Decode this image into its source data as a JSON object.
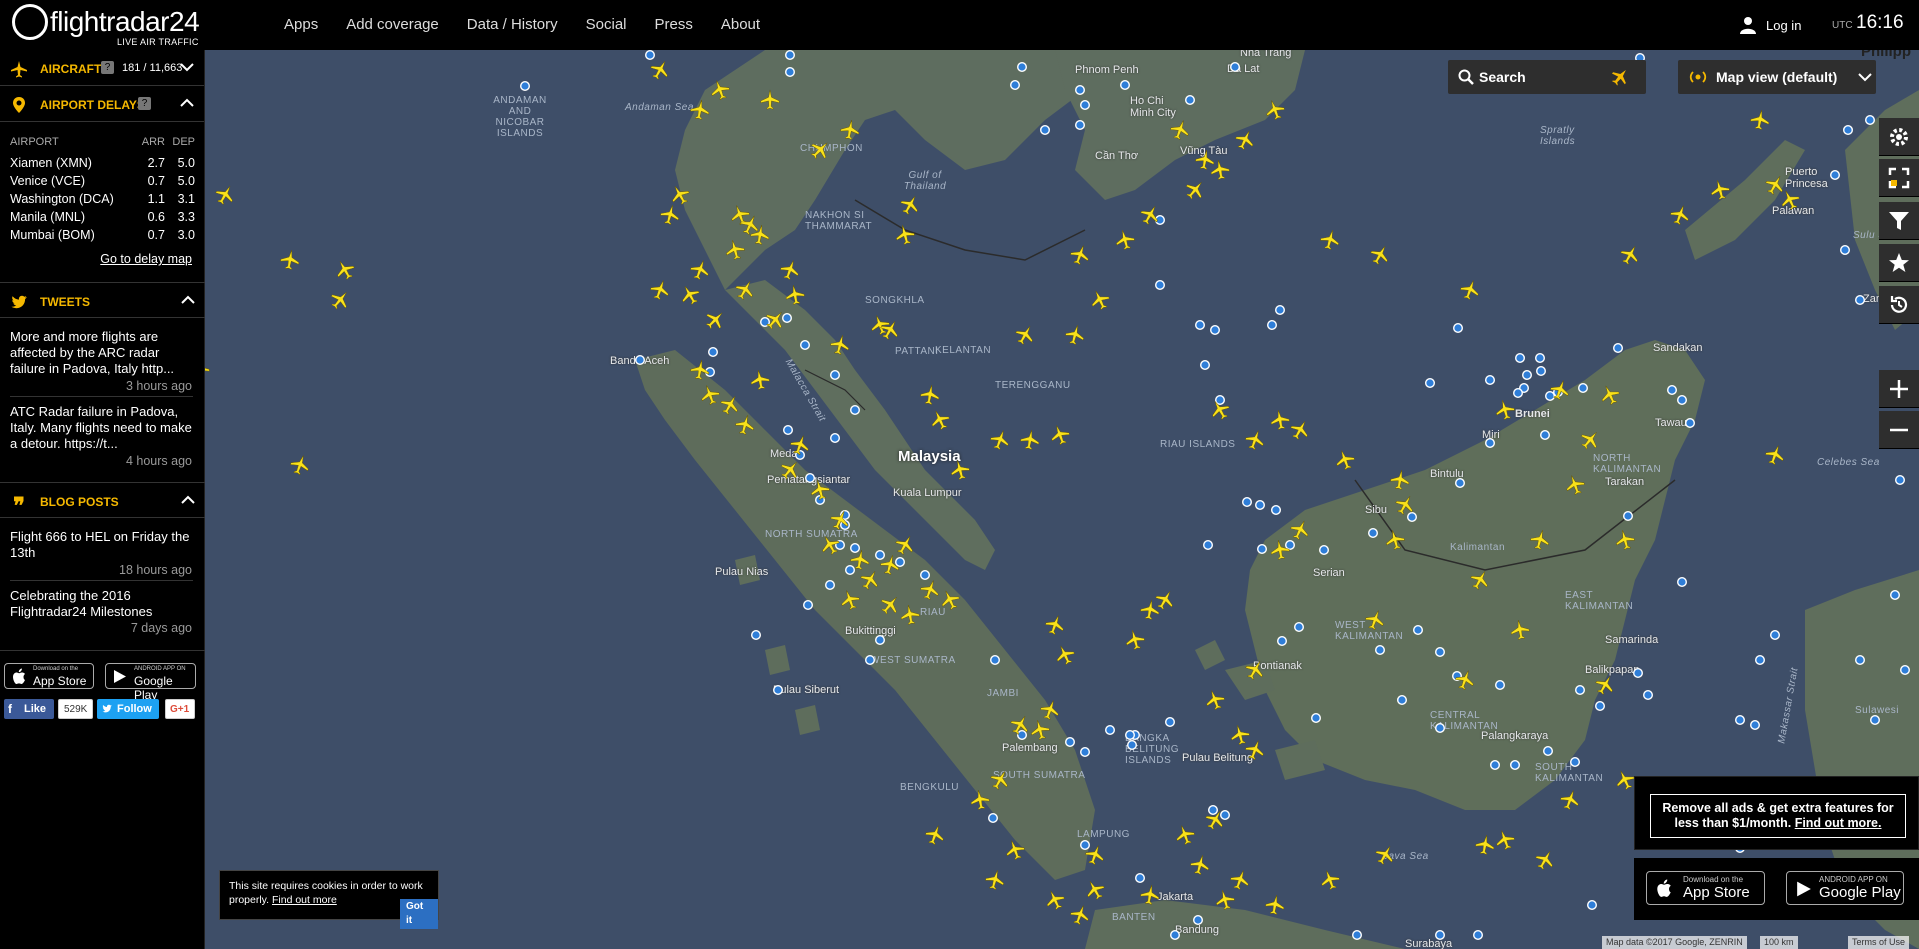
{
  "header": {
    "logo_text": "flightradar24",
    "logo_sub": "LIVE AIR TRAFFIC",
    "nav": [
      "Apps",
      "Add coverage",
      "Data / History",
      "Social",
      "Press",
      "About"
    ],
    "login_label": "Log in",
    "utc_label": "UTC",
    "time": "16:16"
  },
  "sidebar": {
    "aircraft": {
      "title": "AIRCRAFT",
      "count": "181 / 11,663",
      "help": "?"
    },
    "delays": {
      "title": "AIRPORT DELAYS",
      "help": "?",
      "headers": [
        "AIRPORT",
        "ARR",
        "DEP"
      ],
      "rows": [
        [
          "Xiamen (XMN)",
          "2.7",
          "5.0"
        ],
        [
          "Venice (VCE)",
          "0.7",
          "5.0"
        ],
        [
          "Washington (DCA)",
          "1.1",
          "3.1"
        ],
        [
          "Manila (MNL)",
          "0.6",
          "3.3"
        ],
        [
          "Mumbai (BOM)",
          "0.7",
          "3.0"
        ]
      ],
      "link": "Go to delay map"
    },
    "tweets": {
      "title": "TWEETS",
      "items": [
        {
          "text": "More and more flights are affected by the ARC radar failure in Padova, Italy http...",
          "ago": "3 hours ago"
        },
        {
          "text": "ATC Radar failure in Padova, Italy. Many flights need to make a detour. https://t...",
          "ago": "4 hours ago"
        }
      ]
    },
    "blog": {
      "title": "BLOG POSTS",
      "items": [
        {
          "text": "Flight 666 to HEL on Friday the 13th",
          "ago": "18 hours ago"
        },
        {
          "text": "Celebrating the 2016 Flightradar24 Milestones",
          "ago": "7 days ago"
        }
      ]
    },
    "stores": {
      "apple_small": "Download on the",
      "apple_big": "App Store",
      "google_small": "ANDROID APP ON",
      "google_big": "Google Play"
    },
    "social": {
      "like": "Like",
      "like_count": "529K",
      "follow": "Follow",
      "gplus": "G+1"
    }
  },
  "map": {
    "search_label": "Search",
    "mapview_label": "Map view (default)",
    "labels": {
      "andaman": "ANDAMAN AND NICOBAR ISLANDS",
      "andaman_sea": "Andaman Sea",
      "gulf_thailand": "Gulf of Thailand",
      "spratly": "Spratly Islands",
      "hochiminh": "Ho Chi Minh City",
      "vungtau": "Vũng Tàu",
      "cantho": "Cần Thơ",
      "phnompenh": "Phnom Penh",
      "natrang": "Nha Trang",
      "dalat": "Da Lat",
      "bandaaceh": "Banda Aceh",
      "medan": "Medan",
      "pematang": "Pematangsiantar",
      "north_sumatra": "NORTH SUMATRA",
      "malaysia": "Malaysia",
      "kualalumpur": "Kuala Lumpur",
      "riau_islands": "RIAU ISLANDS",
      "riau": "RIAU",
      "west_sumatra": "WEST SUMATRA",
      "jambi": "JAMBI",
      "bukittinggi": "Bukittinggi",
      "pulau_nias": "Pulau Nias",
      "pulau_siberut": "Pulau Siberut",
      "palembang": "Palembang",
      "south_sumatra": "SOUTH SUMATRA",
      "bengkulu": "BENGKULU",
      "lampung": "LAMPUNG",
      "bangka": "BANGKA BELITUNG ISLANDS",
      "pulau_belitung": "Pulau Belitung",
      "banten": "BANTEN",
      "jakarta": "Jakarta",
      "bandung": "Bandung",
      "surabaya": "Surabaya",
      "java_sea": "Java Sea",
      "pontianak": "Pontianak",
      "kalimantan": "Kalimantan",
      "serian": "Serian",
      "sibu": "Sibu",
      "bintulu": "Bintulu",
      "miri": "Miri",
      "brunei": "Brunei",
      "sandakan": "Sandakan",
      "tawau": "Tawau",
      "tarakan": "Tarakan",
      "north_kalimantan": "NORTH KALIMANTAN",
      "east_kalimantan": "EAST KALIMANTAN",
      "west_kalimantan": "WEST KALIMANTAN",
      "central_kalimantan": "CENTRAL KALIMANTAN",
      "south_kalimantan": "SOUTH KALIMANTAN",
      "samarinda": "Samarinda",
      "balikpapan": "Balikpapan",
      "palangkaraya": "Palangkaraya",
      "puerto": "Puerto Princesa",
      "palawan": "Palawan",
      "sulu_sea": "Sulu Sea",
      "celebes": "Celebes Sea",
      "sulawesi": "Sulawesi",
      "makassar": "Makassar Strait",
      "malacca": "Malacca Strait",
      "songkhla": "SONGKHLA",
      "pattani": "PATTANI",
      "kelantan": "KELANTAN",
      "terengganu": "TERENGGANU",
      "nakhon": "NAKHON SI THAMMARAT",
      "chumphon": "CHUMPHON",
      "zamboanga": "Zamboanga",
      "philippines": "Philipp"
    },
    "promo_text": "Remove all ads & get extra features for less than $1/month.",
    "promo_link": "Find out more.",
    "promo_apple_small": "Download on the",
    "promo_apple_big": "App Store",
    "promo_google_small": "ANDROID APP ON",
    "promo_google_big": "Google Play",
    "cookie_text": "This site requires cookies in order to work properly.",
    "cookie_link": "Find out more",
    "cookie_button": "Got it",
    "attribution": "Map data ©2017 Google, ZENRIN",
    "scale": "100 km",
    "terms": "Terms of Use"
  },
  "colors": {
    "accent": "#f5b800",
    "plane": "#f9e11a",
    "water": "#3e4e68",
    "land": "#5a6a60",
    "pin": "#2f7ed8"
  },
  "icons": [
    "plane-icon",
    "pin-icon",
    "search-icon",
    "radio-icon",
    "gear-icon",
    "fullscreen-icon",
    "filter-icon",
    "star-icon",
    "history-icon",
    "zoom-in-icon",
    "zoom-out-icon",
    "user-icon",
    "twitter-icon",
    "quote-icon",
    "chevron-up-icon",
    "chevron-down-icon",
    "apple-icon",
    "google-play-icon"
  ]
}
